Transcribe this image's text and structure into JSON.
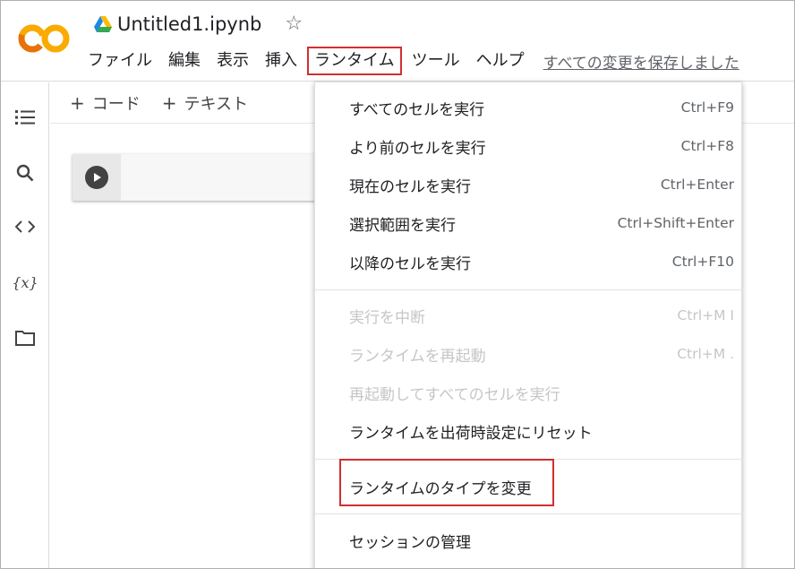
{
  "header": {
    "filename": "Untitled1.ipynb",
    "logo_text": "CO",
    "save_status": "すべての変更を保存しました",
    "menus": [
      {
        "label": "ファイル"
      },
      {
        "label": "編集"
      },
      {
        "label": "表示"
      },
      {
        "label": "挿入"
      },
      {
        "label": "ランタイム"
      },
      {
        "label": "ツール"
      },
      {
        "label": "ヘルプ"
      }
    ]
  },
  "toolbar": {
    "add_code": "コード",
    "add_text": "テキスト",
    "plus": "+"
  },
  "sidebar": {
    "icons": [
      "toc-icon",
      "search-icon",
      "code-snippets-icon",
      "variables-icon",
      "folder-icon"
    ],
    "variables_glyph": "{x}"
  },
  "runtime_menu": {
    "items": [
      {
        "label": "すべてのセルを実行",
        "shortcut": "Ctrl+F9",
        "enabled": true
      },
      {
        "label": "より前のセルを実行",
        "shortcut": "Ctrl+F8",
        "enabled": true
      },
      {
        "label": "現在のセルを実行",
        "shortcut": "Ctrl+Enter",
        "enabled": true
      },
      {
        "label": "選択範囲を実行",
        "shortcut": "Ctrl+Shift+Enter",
        "enabled": true
      },
      {
        "label": "以降のセルを実行",
        "shortcut": "Ctrl+F10",
        "enabled": true
      },
      {
        "label": "実行を中断",
        "shortcut": "Ctrl+M I",
        "enabled": false
      },
      {
        "label": "ランタイムを再起動",
        "shortcut": "Ctrl+M .",
        "enabled": false
      },
      {
        "label": "再起動してすべてのセルを実行",
        "shortcut": "",
        "enabled": false
      },
      {
        "label": "ランタイムを出荷時設定にリセット",
        "shortcut": "",
        "enabled": true
      },
      {
        "label": "ランタイムのタイプを変更",
        "shortcut": "",
        "enabled": true
      },
      {
        "label": "セッションの管理",
        "shortcut": "",
        "enabled": true
      }
    ]
  },
  "colors": {
    "logo_orange": "#F9AB00",
    "logo_dark_orange": "#E8710A",
    "highlight_red": "#D32F2F"
  }
}
